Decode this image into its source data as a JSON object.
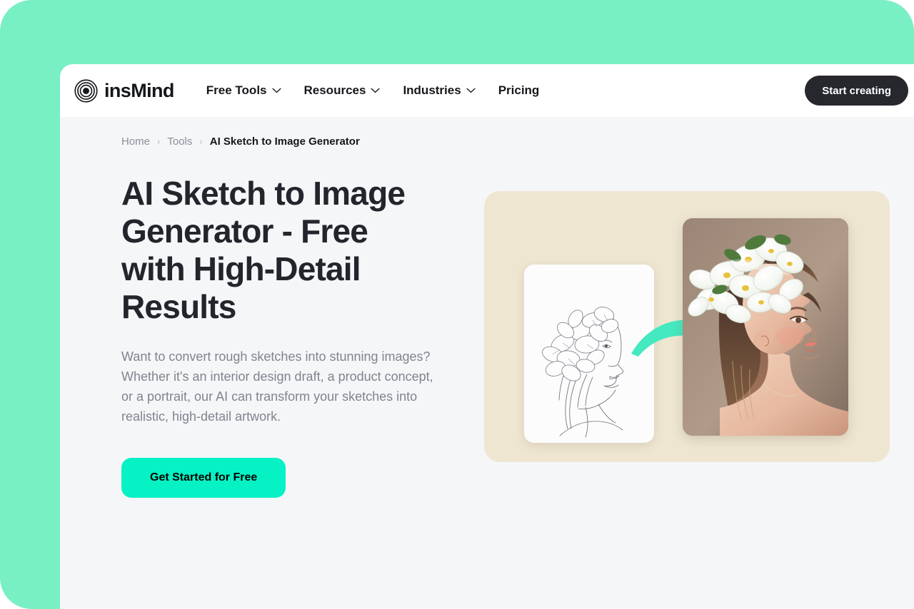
{
  "theme": {
    "frame_green": "#79efc4",
    "page_bg": "#f5f6f8",
    "nav_bg": "#ffffff",
    "cta_green": "#06f2c4",
    "dark": "#26282e",
    "showcase_beige": "#efe6d2",
    "muted_text": "#7f848d",
    "arrow_mint": "#45e9c0"
  },
  "nav": {
    "brand": "insMind",
    "brand_icon": "concentric-circles-logo",
    "links": [
      {
        "label": "Free Tools",
        "has_dropdown": true,
        "icon": "chevron-down-icon"
      },
      {
        "label": "Resources",
        "has_dropdown": true,
        "icon": "chevron-down-icon"
      },
      {
        "label": "Industries",
        "has_dropdown": true,
        "icon": "chevron-down-icon"
      },
      {
        "label": "Pricing",
        "has_dropdown": false,
        "icon": ""
      }
    ],
    "cta_label": "Start creating"
  },
  "breadcrumb": {
    "items": [
      {
        "label": "Home",
        "current": false
      },
      {
        "label": "Tools",
        "current": false
      },
      {
        "label": "AI Sketch to Image Generator",
        "current": true
      }
    ],
    "separator": "›"
  },
  "hero": {
    "title": "AI Sketch to Image Generator - Free with High-Detail Results",
    "description": "Want to convert rough sketches into stunning images? Whether it's an interior design draft, a product concept, or a portrait, our AI can transform your sketches into realistic, high-detail artwork.",
    "cta_label": "Get Started for Free"
  },
  "showcase": {
    "before_alt": "pencil sketch of a woman in profile wearing flowers in her hair",
    "after_alt": "colored painted portrait of a woman in profile with white blossoms in her hair",
    "arrow_icon": "curved-arrow-right-icon"
  }
}
